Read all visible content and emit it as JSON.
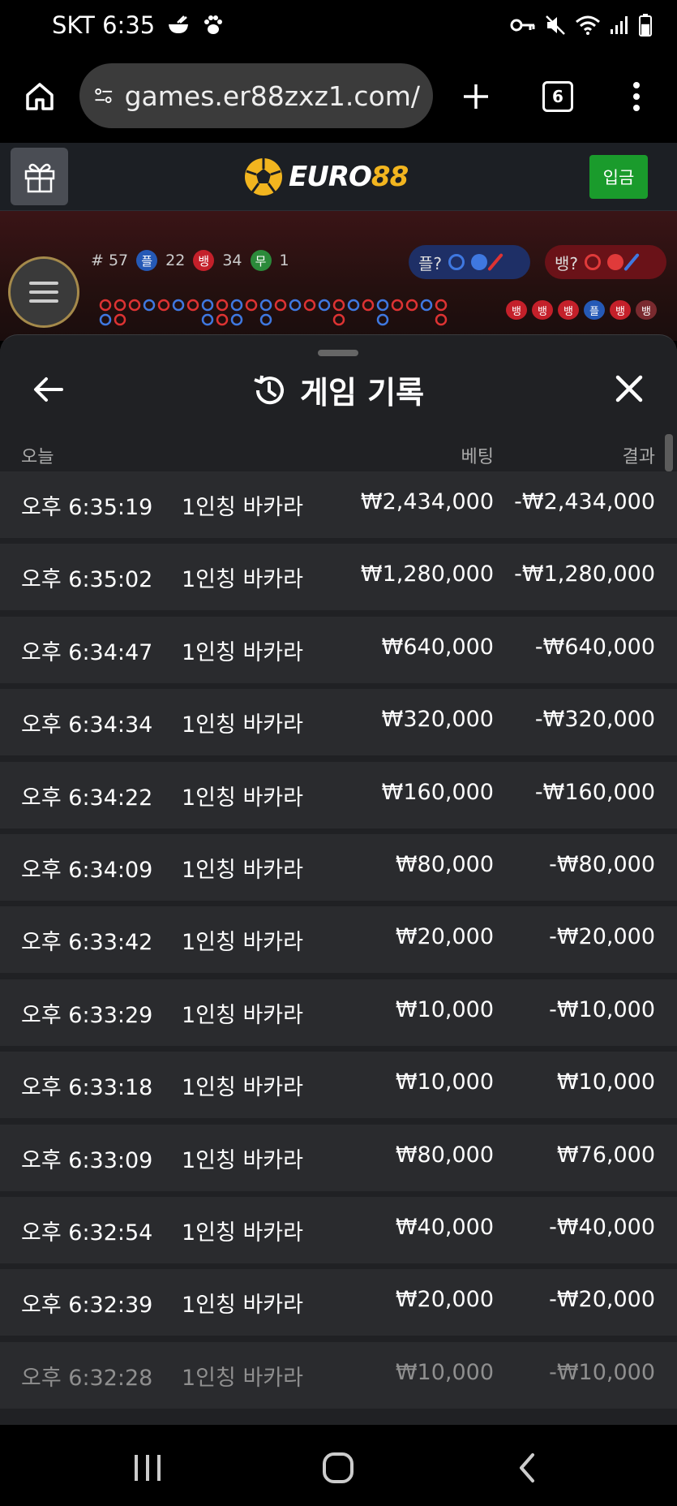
{
  "status_bar": {
    "carrier_time": "SKT 6:35",
    "battery_level": 0.6
  },
  "browser": {
    "url": "games.er88zxz1.com/",
    "tab_count": "6"
  },
  "site_header": {
    "logo_text_a": "EURO",
    "logo_text_b": "88",
    "deposit_label": "입금"
  },
  "game_stats": {
    "round_label": "# 57",
    "player_badge": "플",
    "player_count": "22",
    "banker_badge": "뱅",
    "banker_count": "34",
    "tie_badge": "무",
    "tie_count": "1",
    "player_predict": "플?",
    "banker_predict": "뱅?",
    "chips": [
      "뱅",
      "뱅",
      "뱅",
      "플",
      "뱅",
      "뱅"
    ]
  },
  "sheet": {
    "title": "게임 기록",
    "col_date": "오늘",
    "col_bet": "베팅",
    "col_result": "결과"
  },
  "rows": [
    {
      "time": "오후 6:35:19",
      "game": "1인칭 바카라",
      "bet": "₩2,434,000",
      "result": "-₩2,434,000"
    },
    {
      "time": "오후 6:35:02",
      "game": "1인칭 바카라",
      "bet": "₩1,280,000",
      "result": "-₩1,280,000"
    },
    {
      "time": "오후 6:34:47",
      "game": "1인칭 바카라",
      "bet": "₩640,000",
      "result": "-₩640,000"
    },
    {
      "time": "오후 6:34:34",
      "game": "1인칭 바카라",
      "bet": "₩320,000",
      "result": "-₩320,000"
    },
    {
      "time": "오후 6:34:22",
      "game": "1인칭 바카라",
      "bet": "₩160,000",
      "result": "-₩160,000"
    },
    {
      "time": "오후 6:34:09",
      "game": "1인칭 바카라",
      "bet": "₩80,000",
      "result": "-₩80,000"
    },
    {
      "time": "오후 6:33:42",
      "game": "1인칭 바카라",
      "bet": "₩20,000",
      "result": "-₩20,000"
    },
    {
      "time": "오후 6:33:29",
      "game": "1인칭 바카라",
      "bet": "₩10,000",
      "result": "-₩10,000"
    },
    {
      "time": "오후 6:33:18",
      "game": "1인칭 바카라",
      "bet": "₩10,000",
      "result": "₩10,000"
    },
    {
      "time": "오후 6:33:09",
      "game": "1인칭 바카라",
      "bet": "₩80,000",
      "result": "₩76,000"
    },
    {
      "time": "오후 6:32:54",
      "game": "1인칭 바카라",
      "bet": "₩40,000",
      "result": "-₩40,000"
    },
    {
      "time": "오후 6:32:39",
      "game": "1인칭 바카라",
      "bet": "₩20,000",
      "result": "-₩20,000"
    },
    {
      "time": "오후 6:32:28",
      "game": "1인칭 바카라",
      "bet": "₩10,000",
      "result": "-₩10,000"
    }
  ],
  "colors": {
    "deposit_green": "#1a9b2c",
    "logo_gold": "#f2b51f",
    "sheet_bg": "#202124",
    "row_bg": "#2a2b2e",
    "player_blue": "#2559b6",
    "banker_red": "#c4202a"
  },
  "icons": {
    "home": "home-icon",
    "site_info": "tune-icon",
    "new_tab": "plus-icon",
    "more": "more-vert-icon",
    "gift": "gift-icon",
    "menu": "hamburger-icon",
    "back": "arrow-left-icon",
    "history": "history-icon",
    "close": "close-icon"
  }
}
